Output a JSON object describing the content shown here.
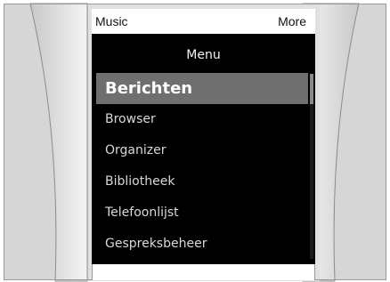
{
  "softkeys": {
    "left": "Music",
    "right": "More"
  },
  "menu": {
    "title": "Menu",
    "items": [
      {
        "label": "Berichten",
        "selected": true
      },
      {
        "label": "Browser",
        "selected": false
      },
      {
        "label": "Organizer",
        "selected": false
      },
      {
        "label": "Bibliotheek",
        "selected": false
      },
      {
        "label": "Telefoonlijst",
        "selected": false
      },
      {
        "label": "Gespreksbeheer",
        "selected": false
      }
    ]
  },
  "colors": {
    "screen": "#000000",
    "highlight": "#6f6f6f",
    "bezel": "#d6d6d6"
  }
}
